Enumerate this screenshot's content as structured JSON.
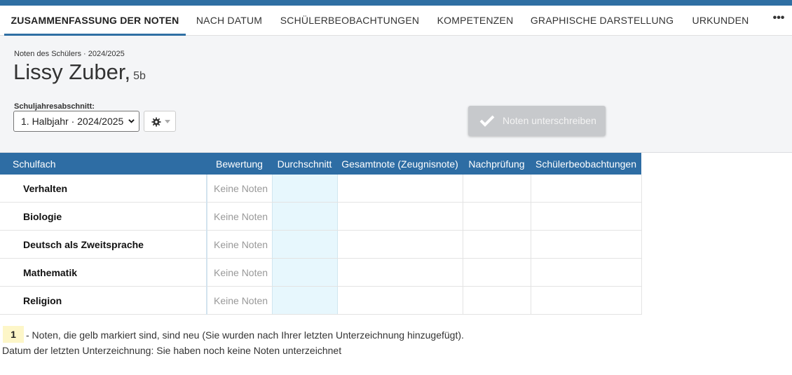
{
  "tabs": [
    {
      "label": "Zusammenfassung der Noten",
      "active": true
    },
    {
      "label": "Nach Datum",
      "active": false
    },
    {
      "label": "Schülerbeobachtungen",
      "active": false
    },
    {
      "label": "Kompetenzen",
      "active": false
    },
    {
      "label": "Graphische Darstellung",
      "active": false
    },
    {
      "label": "Urkunden",
      "active": false
    }
  ],
  "more_label": "•••",
  "header": {
    "subtitle": "Noten des Schülers · 2024/2025",
    "student_name": "Lissy Zuber,",
    "student_class": "5b",
    "period_label": "Schuljahresabschnitt:",
    "period_value": "1. Halbjahr · 2024/2025",
    "sign_button": "Noten unterschreiben"
  },
  "table": {
    "columns": [
      "Schulfach",
      "Bewertung",
      "Durchschnitt",
      "Gesamtnote (Zeugnisnote)",
      "Nachprüfung",
      "Schülerbeobachtungen"
    ],
    "rows": [
      {
        "subject": "Verhalten",
        "grade": "Keine Noten"
      },
      {
        "subject": "Biologie",
        "grade": "Keine Noten"
      },
      {
        "subject": "Deutsch als Zweitsprache",
        "grade": "Keine Noten"
      },
      {
        "subject": "Mathematik",
        "grade": "Keine Noten"
      },
      {
        "subject": "Religion",
        "grade": "Keine Noten"
      }
    ]
  },
  "footer": {
    "legend_badge": "1",
    "legend_text": "- Noten, die gelb markiert sind, sind neu (Sie wurden nach Ihrer letzten Unterzeichnung hinzugefügt).",
    "last_signature": "Datum der letzten Unterzeichnung: Sie haben noch keine Noten unterzeichnet"
  },
  "icons": {
    "gear": "gear-icon",
    "check": "check-icon",
    "select_caret": "chevron-down-icon",
    "more": "more-horizontal-icon"
  },
  "colors": {
    "accent": "#2f6fa3",
    "table_header": "#2e6da4",
    "average_column": "#e7f7fd",
    "new_grade_highlight": "#fdf6c8",
    "disabled_button": "#c7c9cc"
  }
}
